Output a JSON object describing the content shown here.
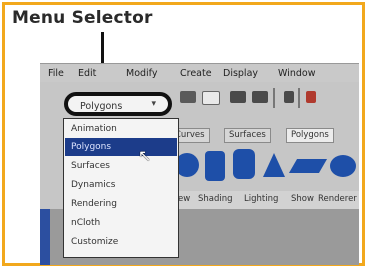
{
  "callout": {
    "title": "Menu Selector"
  },
  "menubar": {
    "items": [
      "File",
      "Edit",
      "Modify",
      "Create",
      "Display",
      "Window"
    ]
  },
  "menu_selector": {
    "value": "Polygons",
    "arrow": "▾"
  },
  "shelf_tabs": [
    "Curves",
    "Surfaces",
    "Polygons"
  ],
  "dropdown": {
    "items": [
      "Animation",
      "Polygons",
      "Surfaces",
      "Dynamics",
      "Rendering",
      "nCloth",
      "Customize"
    ],
    "selected": "Polygons"
  },
  "panel_menu": {
    "items": [
      "View",
      "Shading",
      "Lighting",
      "Show",
      "Renderer"
    ]
  },
  "colors": {
    "frame": "#f2a81c",
    "selection": "#1c3c8a",
    "shelf_icons": "#1e4fa8"
  }
}
